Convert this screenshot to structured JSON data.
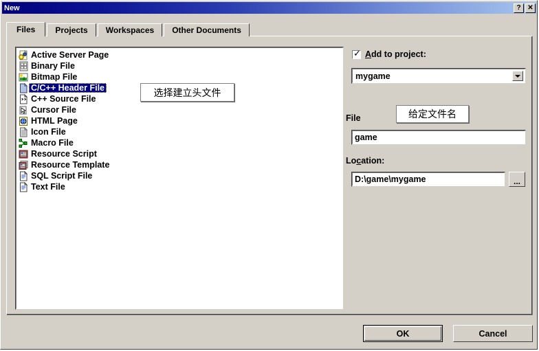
{
  "window": {
    "title": "New",
    "help_button": "?",
    "close_button": "✕"
  },
  "tabs": [
    {
      "label": "Files",
      "active": true
    },
    {
      "label": "Projects",
      "active": false
    },
    {
      "label": "Workspaces",
      "active": false
    },
    {
      "label": "Other Documents",
      "active": false
    }
  ],
  "file_type_list": {
    "selected": "C/C++ Header File",
    "items": [
      {
        "label": "Active Server Page",
        "icon": "active-server-page-icon"
      },
      {
        "label": "Binary File",
        "icon": "binary-file-icon"
      },
      {
        "label": "Bitmap File",
        "icon": "bitmap-file-icon"
      },
      {
        "label": "C/C++ Header File",
        "icon": "header-file-icon"
      },
      {
        "label": "C++ Source File",
        "icon": "cpp-source-file-icon"
      },
      {
        "label": "Cursor File",
        "icon": "cursor-file-icon"
      },
      {
        "label": "HTML Page",
        "icon": "html-page-icon"
      },
      {
        "label": "Icon File",
        "icon": "icon-file-icon"
      },
      {
        "label": "Macro File",
        "icon": "macro-file-icon"
      },
      {
        "label": "Resource Script",
        "icon": "resource-script-icon"
      },
      {
        "label": "Resource Template",
        "icon": "resource-template-icon"
      },
      {
        "label": "SQL Script File",
        "icon": "sql-script-file-icon"
      },
      {
        "label": "Text File",
        "icon": "text-file-icon"
      }
    ]
  },
  "add_to_project": {
    "checked": true,
    "label_prefix": "",
    "label_accel": "A",
    "label_rest": "dd to project:",
    "full_label": "Add to project:",
    "project_value": "mygame",
    "dropdown_arrow": "▼"
  },
  "file_field": {
    "label": "File",
    "value": "game"
  },
  "location_field": {
    "label_prefix": "Lo",
    "label_accel": "c",
    "label_rest": "ation:",
    "full_label": "Location:",
    "value": "D:\\game\\mygame",
    "browse_button": "..."
  },
  "annotations": [
    {
      "text": "选择建立头文件"
    },
    {
      "text": "给定文件名"
    }
  ],
  "buttons": {
    "ok": "OK",
    "cancel": "Cancel"
  },
  "colors": {
    "dialog_face": "#d4d0c8",
    "title_gradient_start": "#00007b",
    "title_gradient_end": "#a8c6ee",
    "selection_blue": "#000080",
    "selection_text": "#ffffff",
    "field_background": "#ffffff",
    "text": "#000000"
  }
}
